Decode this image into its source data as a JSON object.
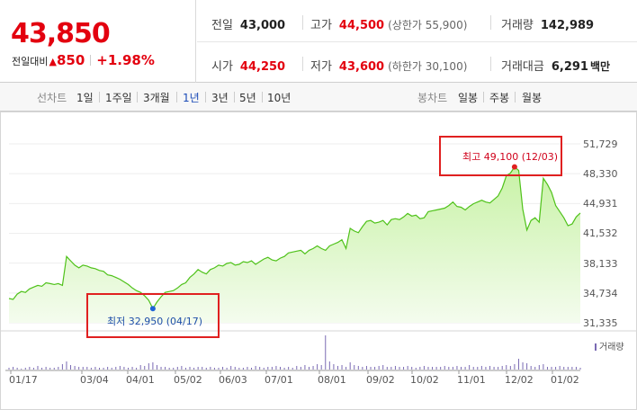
{
  "price": {
    "current": "43,850",
    "change_label": "전일대비",
    "change_arrow": "▲",
    "change_value": "850",
    "change_pct": "+1.98%"
  },
  "stats": {
    "prev_close": {
      "label": "전일",
      "value": "43,000"
    },
    "high": {
      "label": "고가",
      "value": "44,500",
      "limit": "(상한가 55,900)"
    },
    "volume": {
      "label": "거래량",
      "value": "142,989"
    },
    "open": {
      "label": "시가",
      "value": "44,250"
    },
    "low": {
      "label": "저가",
      "value": "43,600",
      "limit": "(하한가 30,100)"
    },
    "amount": {
      "label": "거래대금",
      "value": "6,291",
      "unit": "백만"
    }
  },
  "line_tabs": {
    "header": "선차트",
    "items": [
      "1일",
      "1주일",
      "3개월",
      "1년",
      "3년",
      "5년",
      "10년"
    ],
    "active": "1년"
  },
  "candle_tabs": {
    "header": "봉차트",
    "items": [
      "일봉",
      "주봉",
      "월봉"
    ]
  },
  "colors": {
    "up": "#e3000f",
    "active_tab": "#1b4bb7",
    "line": "#4fc21a",
    "fill": "#c8f2a6",
    "volume": "#7a6ab3"
  },
  "chart_data": {
    "type": "area",
    "y_ticks": [
      "51,729",
      "48,330",
      "44,931",
      "41,532",
      "38,133",
      "34,734",
      "31,335"
    ],
    "ylim": [
      31335,
      51729
    ],
    "x_ticks": [
      "01/17",
      "03/04",
      "04/01",
      "05/02",
      "06/03",
      "07/01",
      "08/01",
      "09/02",
      "10/02",
      "11/01",
      "12/02",
      "01/02"
    ],
    "volume_label": "거래량",
    "high_label": "최고 49,100 (12/03)",
    "low_label": "최저 32,950 (04/17)",
    "high": 49100,
    "low": 32950,
    "series": [
      34100,
      34000,
      34600,
      34900,
      34800,
      35200,
      35400,
      35600,
      35500,
      35900,
      35800,
      35700,
      35800,
      35600,
      38900,
      38400,
      37900,
      37600,
      37900,
      37800,
      37600,
      37500,
      37300,
      37200,
      36800,
      36700,
      36500,
      36300,
      36000,
      35700,
      35300,
      35000,
      34800,
      34400,
      33900,
      32950,
      33700,
      34300,
      34800,
      34900,
      35000,
      35300,
      35700,
      35900,
      36500,
      36900,
      37400,
      37100,
      36900,
      37400,
      37600,
      37900,
      37800,
      38100,
      38200,
      37900,
      38000,
      38300,
      38200,
      38400,
      38000,
      38300,
      38600,
      38800,
      38500,
      38400,
      38700,
      38900,
      39300,
      39400,
      39500,
      39600,
      39200,
      39600,
      39800,
      40100,
      39800,
      39600,
      40100,
      40300,
      40500,
      40800,
      39800,
      42100,
      41800,
      41600,
      42300,
      42900,
      43000,
      42700,
      42800,
      43000,
      42500,
      43100,
      43200,
      43100,
      43400,
      43800,
      43500,
      43600,
      43200,
      43300,
      44000,
      44100,
      44200,
      44300,
      44400,
      44700,
      45100,
      44600,
      44500,
      44200,
      44600,
      44900,
      45100,
      45300,
      45100,
      45000,
      45400,
      45800,
      46700,
      48100,
      48400,
      49100,
      48700,
      44300,
      41900,
      43000,
      43300,
      42800,
      47800,
      47100,
      46200,
      44700,
      44000,
      43300,
      42400,
      42600,
      43400,
      43850
    ],
    "volume": [
      2,
      3,
      2,
      1,
      2,
      3,
      2,
      4,
      2,
      3,
      2,
      2,
      3,
      6,
      9,
      5,
      4,
      3,
      3,
      3,
      2,
      3,
      2,
      2,
      3,
      2,
      3,
      4,
      3,
      2,
      3,
      2,
      5,
      4,
      7,
      8,
      5,
      3,
      3,
      2,
      2,
      3,
      4,
      2,
      3,
      2,
      3,
      3,
      2,
      3,
      2,
      2,
      3,
      2,
      4,
      3,
      2,
      2,
      3,
      2,
      4,
      3,
      2,
      3,
      3,
      4,
      3,
      2,
      3,
      2,
      4,
      3,
      5,
      3,
      4,
      6,
      5,
      38,
      9,
      6,
      4,
      5,
      3,
      8,
      5,
      4,
      3,
      4,
      3,
      3,
      4,
      5,
      3,
      3,
      4,
      3,
      3,
      4,
      3,
      2,
      3,
      4,
      3,
      3,
      3,
      3,
      4,
      3,
      3,
      4,
      3,
      3,
      5,
      3,
      3,
      4,
      3,
      4,
      3,
      3,
      4,
      5,
      4,
      6,
      12,
      8,
      7,
      4,
      3,
      5,
      6,
      3,
      3,
      3,
      4,
      3,
      3,
      3,
      3,
      2
    ]
  }
}
